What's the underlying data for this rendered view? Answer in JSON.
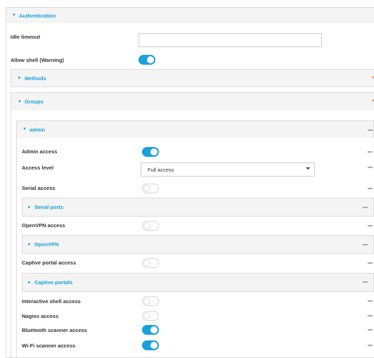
{
  "authentication": {
    "title": "Authentication",
    "idle_timeout": {
      "label": "Idle timeout",
      "value": "",
      "placeholder": ""
    },
    "allow_shell": {
      "label": "Allow shell (Warning)",
      "on": true
    }
  },
  "methods": {
    "title": "Methods"
  },
  "groups": {
    "title": "Groups"
  },
  "admin": {
    "title": "admin",
    "admin_access": {
      "label": "Admin access",
      "on": true
    },
    "access_level": {
      "label": "Access level",
      "value": "Full access"
    },
    "serial_access": {
      "label": "Serial access",
      "on": false
    },
    "serial_ports": {
      "title": "Serial ports"
    },
    "openvpn_access": {
      "label": "OpenVPN access",
      "on": false
    },
    "openvpn": {
      "title": "OpenVPN"
    },
    "captive_portal_access": {
      "label": "Captive portal access",
      "on": false
    },
    "captive_portals": {
      "title": "Captive portals"
    },
    "interactive_shell_access": {
      "label": "Interactive shell access",
      "on": false
    },
    "nagios_access": {
      "label": "Nagios access",
      "on": false
    },
    "bluetooth_scanner_access": {
      "label": "Bluetooth scanner access",
      "on": true
    },
    "wifi_scanner_access": {
      "label": "Wi-Fi scanner access",
      "on": true
    }
  },
  "icons": {
    "expanded": "caret-down-icon",
    "collapsed": "caret-right-icon",
    "remove": "minus-icon"
  },
  "colors": {
    "accent": "#1aa0db",
    "header_bg": "#f4f4f4",
    "border": "#dcdcdc"
  }
}
